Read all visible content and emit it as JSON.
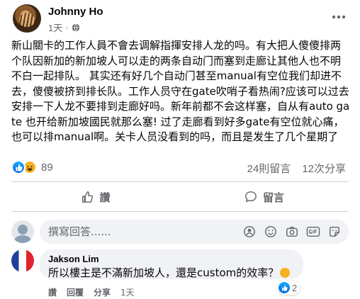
{
  "post": {
    "author": "Johnny Ho",
    "time": "1天",
    "body": "新山關卡的工作人員不會去调解指揮安排人龙的吗。有大把人傻傻排两个队因新加的新加坡人可以走的两条自动门而塞到走廊让其他人也不明不白一起排队。 其实还有好几个自动门甚至manual有空位我们却进不去，傻傻被挤到排长队。工作人员守在gate吹哨子看热闹?应该可以过去安排一下人龙不要排到走廊好吗。新年前都不会这样塞，自从有auto gate 也开给新加坡國民就那么塞! 过了走廊看到好多gate有空位就心痛，也可以排manual啊。关卡人员没看到的吗，而且是发生了几个星期了",
    "reactions": {
      "count": "89",
      "types": [
        "like-icon",
        "haha-icon"
      ]
    },
    "comments_count": "24則留言",
    "shares_count": "12次分享"
  },
  "actions": {
    "like": "讚",
    "comment": "留言"
  },
  "comment_input": {
    "placeholder": "撰寫回答......"
  },
  "reply": {
    "author": "Jakson Lim",
    "text": "所以樓主是不滿新加坡人，還是custom的效率？",
    "reaction_count": "2",
    "like": "讚",
    "reply_label": "回覆",
    "share": "分享",
    "time": "1天"
  },
  "colors": {
    "accent": "#0866ff",
    "muted": "#65676b",
    "bubble": "#f0f2f5"
  }
}
